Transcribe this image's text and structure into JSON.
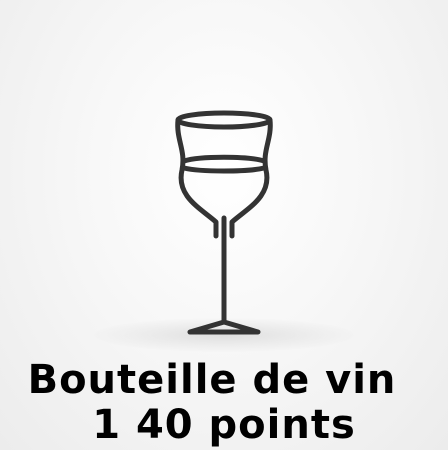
{
  "caption": {
    "title": "Bouteille de vin",
    "points": "1 40 points"
  },
  "icon": {
    "name": "wine-glass-icon",
    "stroke_color": "#333333"
  },
  "colors": {
    "background": "#f7f7f7",
    "text": "#000000"
  }
}
